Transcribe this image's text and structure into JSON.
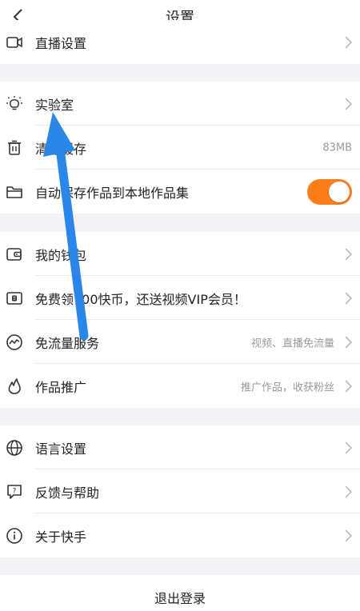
{
  "header": {
    "title": "设置",
    "back_icon": "chevron-left-icon"
  },
  "rows": [
    {
      "label": "直播设置",
      "icon": "video-camera-icon"
    },
    {
      "label": "实验室",
      "icon": "lightbulb-icon"
    },
    {
      "label": "清除缓存",
      "value": "83MB",
      "icon": "trash-icon"
    },
    {
      "label": "自动保存作品到本地作品集",
      "icon": "folder-icon",
      "toggle_on": true
    },
    {
      "label": "我的钱包",
      "icon": "wallet-icon"
    },
    {
      "label": "免费领700快币，还送视频VIP会员！",
      "icon": "coupon-icon"
    },
    {
      "label": "免流量服务",
      "value": "视频、直播免流量",
      "icon": "data-traffic-icon"
    },
    {
      "label": "作品推广",
      "value": "推广作品，收获粉丝",
      "icon": "flame-icon"
    },
    {
      "label": "语言设置",
      "icon": "globe-icon"
    },
    {
      "label": "反馈与帮助",
      "icon": "help-chat-icon"
    },
    {
      "label": "关于快手",
      "icon": "info-icon"
    }
  ],
  "logout_label": "退出登录",
  "colors": {
    "accent": "#fe7d1b",
    "annotation_arrow": "#2a86e8",
    "background": "#f4f2f7"
  }
}
